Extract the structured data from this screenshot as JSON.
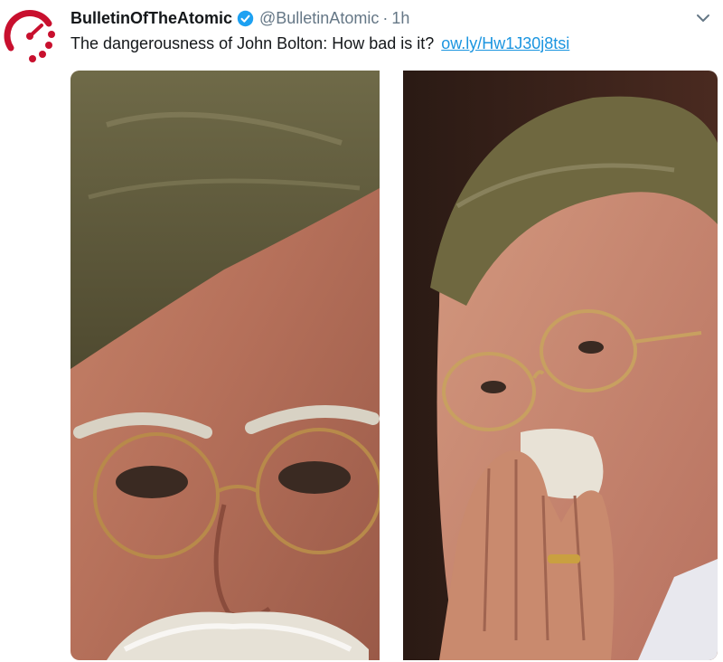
{
  "tweet": {
    "display_name": "BulletinOfTheAtomic",
    "handle": "@BulletinAtomic",
    "separator": "·",
    "time": "1h",
    "text": "The dangerousness of John Bolton: How bad is it?",
    "link": "ow.ly/Hw1J30j8tsi"
  },
  "icons": {
    "avatar": "doomsday-clock-logo",
    "verified": "verified-badge-icon",
    "menu": "chevron-down-icon"
  },
  "colors": {
    "brand_red": "#c8102e",
    "verified_blue": "#1da1f2",
    "link_blue": "#1b95e0",
    "name_text": "#14171a",
    "meta_text": "#657786"
  }
}
